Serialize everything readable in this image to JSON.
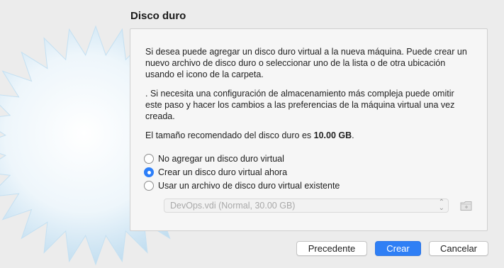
{
  "dialog": {
    "title": "Disco duro",
    "paragraph1": "Si desea puede agregar un disco duro virtual a la nueva máquina. Puede crear un nuevo archivo de disco duro o seleccionar uno de la lista o de otra ubicación usando el icono de la carpeta.",
    "paragraph2": ". Si necesita una configuración de almacenamiento más compleja puede omitir este paso y hacer los cambios a las preferencias de la máquina virtual una vez creada.",
    "size_prefix": "El tamaño recomendado del disco duro es ",
    "size_value": "10.00 GB",
    "size_suffix": "."
  },
  "options": [
    {
      "label": "No agregar un disco duro virtual",
      "selected": false
    },
    {
      "label": "Crear un disco duro virtual ahora",
      "selected": true
    },
    {
      "label": "Usar un archivo de disco duro virtual existente",
      "selected": false
    }
  ],
  "disk_select": {
    "value": "DevOps.vdi (Normal, 30.00 GB)",
    "enabled": false
  },
  "buttons": {
    "back": "Precedente",
    "create": "Crear",
    "cancel": "Cancelar"
  },
  "colors": {
    "accent": "#2f7ff5",
    "background": "#ececec",
    "panel": "#f6f6f6"
  },
  "icons": {
    "art": "hard-disk-starburst-icon",
    "folder": "folder-icon",
    "select_arrows": "up-down-chevron-icon"
  }
}
